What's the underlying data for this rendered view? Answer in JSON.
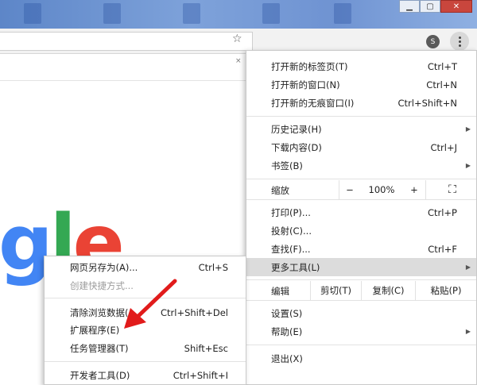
{
  "window": {
    "minimize_label": "▁",
    "maximize_label": "▢",
    "close_label": "✕"
  },
  "toolbar": {
    "profile_initial": "S",
    "strip_close": "×"
  },
  "logo": {
    "g": "g",
    "l": "l",
    "e": "e"
  },
  "menu": {
    "items": [
      {
        "label": "打开新的标签页(T)",
        "shortcut": "Ctrl+T"
      },
      {
        "label": "打开新的窗口(N)",
        "shortcut": "Ctrl+N"
      },
      {
        "label": "打开新的无痕窗口(I)",
        "shortcut": "Ctrl+Shift+N"
      },
      {
        "label": "历史记录(H)",
        "shortcut": ""
      },
      {
        "label": "下载内容(D)",
        "shortcut": "Ctrl+J"
      },
      {
        "label": "书签(B)",
        "shortcut": ""
      },
      {
        "label": "打印(P)...",
        "shortcut": "Ctrl+P"
      },
      {
        "label": "投射(C)...",
        "shortcut": ""
      },
      {
        "label": "查找(F)...",
        "shortcut": "Ctrl+F"
      },
      {
        "label": "更多工具(L)",
        "shortcut": ""
      },
      {
        "label": "设置(S)",
        "shortcut": ""
      },
      {
        "label": "帮助(E)",
        "shortcut": ""
      },
      {
        "label": "退出(X)",
        "shortcut": ""
      }
    ],
    "zoom": {
      "label": "缩放",
      "minus": "−",
      "value": "100%",
      "plus": "+",
      "fullscreen": "⛶"
    },
    "edit": {
      "label": "编辑",
      "cut": "剪切(T)",
      "copy": "复制(C)",
      "paste": "粘贴(P)"
    }
  },
  "submenu": {
    "items": [
      {
        "label": "网页另存为(A)...",
        "shortcut": "Ctrl+S"
      },
      {
        "label": "创建快捷方式...",
        "shortcut": ""
      },
      {
        "label": "清除浏览数据(",
        "shortcut": "Ctrl+Shift+Del"
      },
      {
        "label": "扩展程序(E)",
        "shortcut": ""
      },
      {
        "label": "任务管理器(T)",
        "shortcut": "Shift+Esc"
      },
      {
        "label": "开发者工具(D)",
        "shortcut": "Ctrl+Shift+I"
      }
    ]
  }
}
